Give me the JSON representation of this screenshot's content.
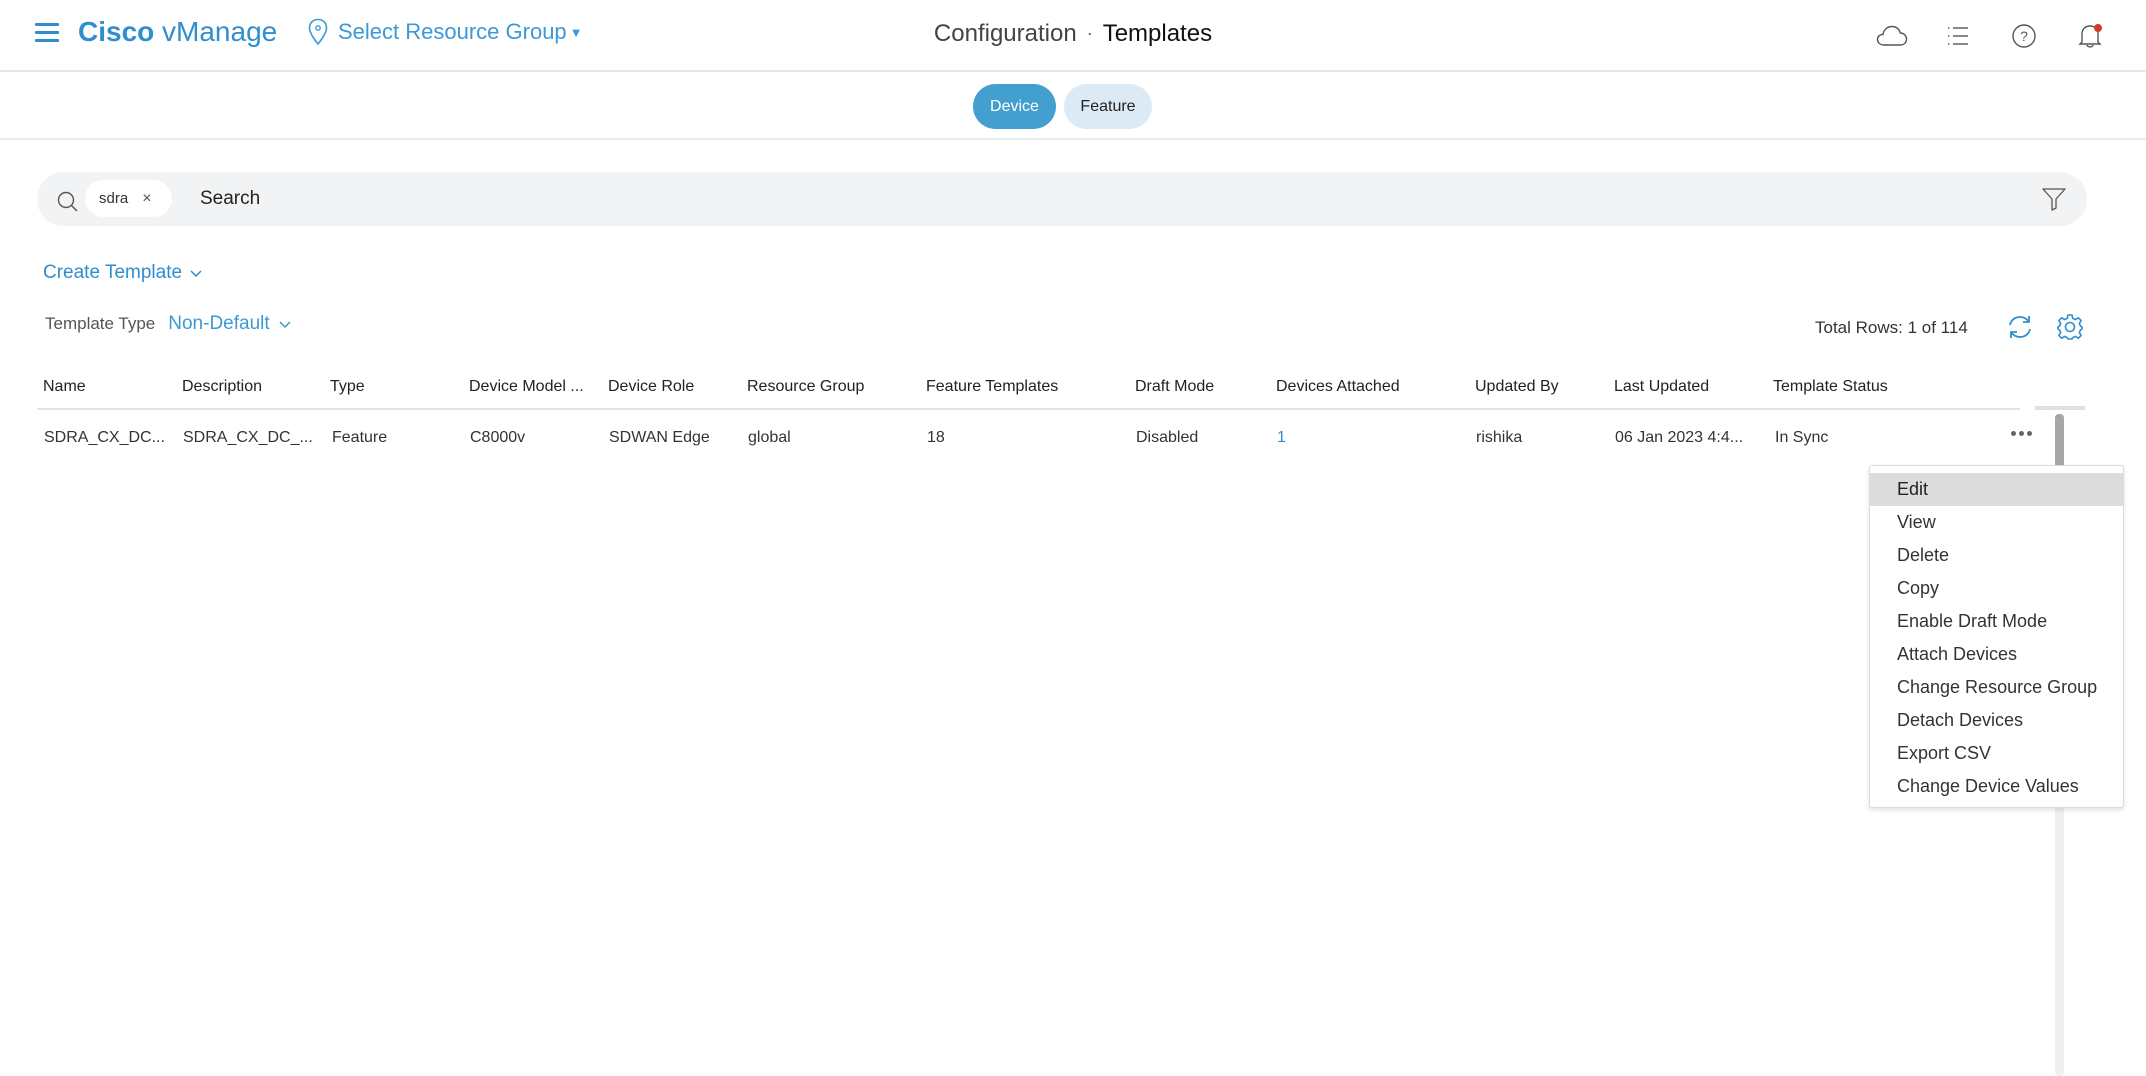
{
  "header": {
    "brand_bold": "Cisco",
    "brand_light": "vManage",
    "resource_group": "Select Resource Group",
    "breadcrumb_section": "Configuration",
    "breadcrumb_separator": "·",
    "breadcrumb_current": "Templates",
    "icons": [
      "cloud-icon",
      "task-list-icon",
      "help-icon",
      "notification-bell-icon"
    ],
    "notification_dot_color": "#d43a2c",
    "brand_color": "#2e8ece"
  },
  "tabs": [
    {
      "label": "Device",
      "active": true
    },
    {
      "label": "Feature",
      "active": false
    }
  ],
  "search": {
    "chip": "sdra",
    "placeholder": "Search"
  },
  "toolbar": {
    "create_template": "Create Template",
    "template_type_label": "Template Type",
    "template_type_value": "Non-Default",
    "total_rows": "Total Rows: 1 of 114"
  },
  "table": {
    "columns": [
      "Name",
      "Description",
      "Type",
      "Device Model ...",
      "Device Role",
      "Resource Group",
      "Feature Templates",
      "Draft Mode",
      "Devices Attached",
      "Updated By",
      "Last Updated",
      "Template Status"
    ],
    "rows": [
      [
        "SDRA_CX_DC...",
        "SDRA_CX_DC_...",
        "Feature",
        "C8000v",
        "SDWAN Edge",
        "global",
        "18",
        "Disabled",
        "1",
        "rishika",
        "06 Jan 2023 4:4...",
        "In Sync"
      ]
    ]
  },
  "context_menu": {
    "items": [
      "Edit",
      "View",
      "Delete",
      "Copy",
      "Enable Draft Mode",
      "Attach Devices",
      "Change Resource Group",
      "Detach Devices",
      "Export CSV",
      "Change Device Values"
    ],
    "highlighted": "Edit"
  }
}
